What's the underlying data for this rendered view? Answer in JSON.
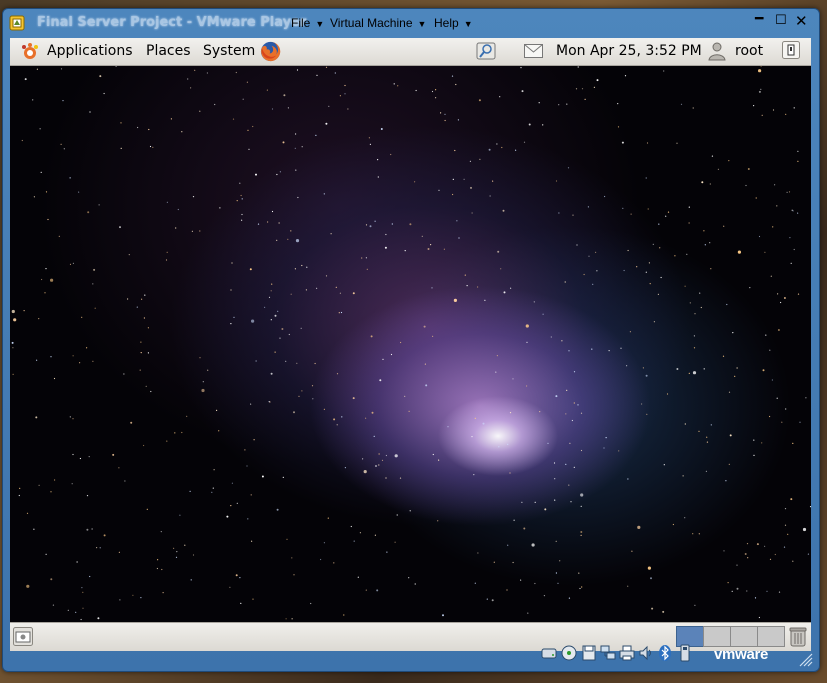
{
  "window": {
    "title": "Final Server Project - VMware Player",
    "menu": [
      {
        "label": "File"
      },
      {
        "label": "Virtual Machine"
      },
      {
        "label": "Help"
      }
    ],
    "controls": {
      "minimize": "━",
      "maximize": "☐",
      "close": "✕"
    }
  },
  "guest": {
    "panel": {
      "menus": {
        "applications": "Applications",
        "places": "Places",
        "system": "System"
      },
      "clock": "Mon Apr 25,  3:52 PM",
      "user": "root",
      "icons": [
        "gnome-foot-icon",
        "firefox-icon",
        "network-icon",
        "mail-icon",
        "user-icon",
        "shutdown-icon"
      ]
    },
    "desktop": {
      "wallpaper": "comet-in-starfield"
    },
    "taskbar": {
      "workspaces": [
        {
          "active": true
        },
        {
          "active": false
        },
        {
          "active": false
        },
        {
          "active": false
        }
      ],
      "icons": [
        "show-desktop-icon",
        "trash-icon"
      ]
    }
  },
  "statusbar": {
    "devices": [
      "hard-disk-icon",
      "cd-dvd-icon",
      "floppy-icon",
      "network-adapter-icon",
      "printer-icon",
      "sound-icon",
      "bluetooth-icon",
      "usb-icon"
    ],
    "brand": "vmware"
  },
  "colors": {
    "window_frame": "#4d86bd",
    "workspace_active": "#5b83b9",
    "panel": "#e8e6e2"
  }
}
